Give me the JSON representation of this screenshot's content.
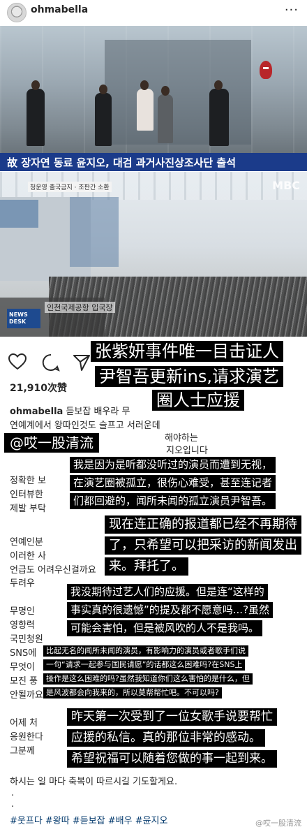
{
  "header": {
    "username": "ohmabella",
    "more_label": "···"
  },
  "photo1": {
    "caption": "故 장자연 동료 윤지오, 대검 과거사진상조사단 출석"
  },
  "photo2": {
    "watermark": "MBC",
    "sign": "청운영 출국금지 · 조판간 소환",
    "subtitle": "인천국제공항 입국장",
    "newsdesk": "NEWS DESK"
  },
  "actions": {
    "likes": "21,910次赞"
  },
  "caption": {
    "lines": [
      {
        "user": "ohmabella",
        "text": "듣보잡 배우라 무"
      },
      {
        "text": "연예계에서 왕따인것도 슬프고 서러운데"
      },
      {
        "text": "해야하는"
      },
      {
        "text": "지오입니다"
      },
      {
        "text": "정확한 보"
      },
      {
        "text": "인터뷰한"
      },
      {
        "text": "제발 부탁"
      },
      {
        "text": "연예인분"
      },
      {
        "text": "이러한 사"
      },
      {
        "text": "언급도 어려우신걸까요"
      },
      {
        "text": "두려우"
      },
      {
        "text": "무명인"
      },
      {
        "text": "영향력"
      },
      {
        "text": "국민청원"
      },
      {
        "text": "SNS에"
      },
      {
        "text": "무엇이"
      },
      {
        "text": "모진 풍"
      },
      {
        "text": "안될까요"
      },
      {
        "text": "어제 처"
      },
      {
        "text": "응원한다"
      },
      {
        "text": "그분께"
      },
      {
        "text": "하시는 일 마다 축복이 따르시길 기도할게요."
      }
    ],
    "dots": ".",
    "hashtags": "#웃프다 #왕따 #듣보잡 #배우 #윤지오"
  },
  "overlays": {
    "headline": [
      "张紫妍事件唯一目击证人",
      "尹智吾更新ins,请求演艺",
      "圈人士应援"
    ],
    "handle": "@哎一股清流",
    "p1": [
      "我是因为是听都没听过的演员而遭到无视，",
      "在演艺圈被孤立，很伤心难受，甚至连记者",
      "们都回避的，闻所未闻的孤立演员尹智吾。"
    ],
    "p2": [
      "现在连正确的报道都已经不再期待",
      "了，只希望可以把采访的新闻发出",
      "来。拜托了。"
    ],
    "p3": [
      "我没期待过艺人们的应援。但是连“这样的",
      "事实真的很遗憾”的提及都不愿意吗...?虽然",
      "可能会害怕，但是被风吹的人不是我吗。"
    ],
    "p4": [
      "比起无名的闻所未闻的演员，有影响力的演员或者歌手们说",
      "一句“请求一起参与国民请愿”的话都这么困难吗?在SNS上",
      "操作是这么困难的吗?虽然我知道你们这么害怕的是什么，但",
      "是风波都会向我来的，所以莫帮帮忙吧。不可以吗?"
    ],
    "p5": [
      "昨天第一次受到了一位女歌手说要帮忙",
      "应援的私信。真的那位非常的感动。",
      "希望祝福可以随着您做的事一起到来。"
    ],
    "weibo": "@哎一股清流"
  }
}
